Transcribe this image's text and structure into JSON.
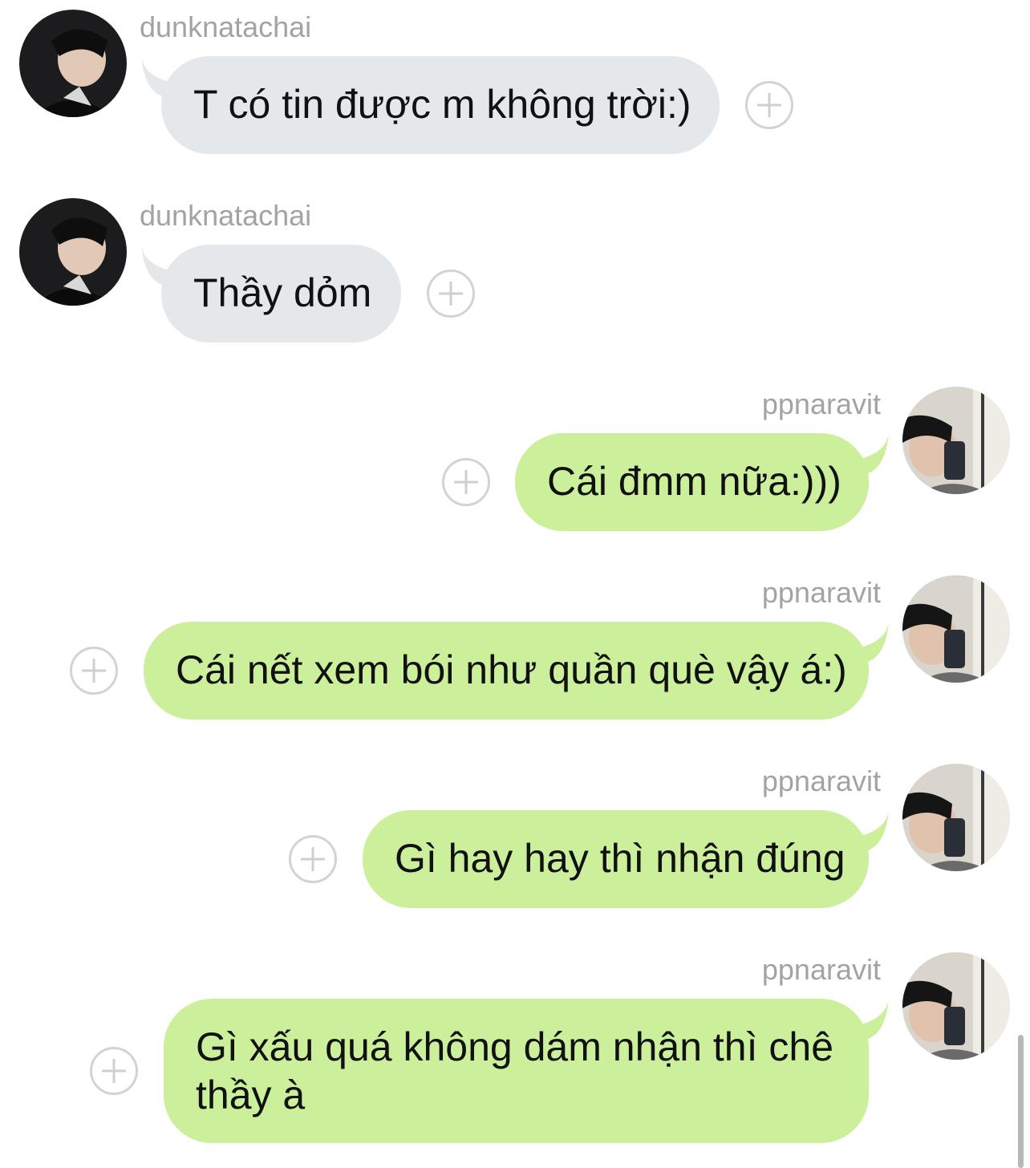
{
  "messages": [
    {
      "sender": "dunknatachai",
      "direction": "incoming",
      "text": "T có tin được m không trời:)",
      "avatar_icon": "user-avatar-dark"
    },
    {
      "sender": "dunknatachai",
      "direction": "incoming",
      "text": "Thầy dỏm",
      "avatar_icon": "user-avatar-dark"
    },
    {
      "sender": "ppnaravit",
      "direction": "outgoing",
      "text": "Cái đmm nữa:)))",
      "avatar_icon": "user-avatar-light"
    },
    {
      "sender": "ppnaravit",
      "direction": "outgoing",
      "text": "Cái nết xem bói như quần què vậy á:)",
      "avatar_icon": "user-avatar-light"
    },
    {
      "sender": "ppnaravit",
      "direction": "outgoing",
      "text": "Gì hay hay thì nhận đúng",
      "avatar_icon": "user-avatar-light"
    },
    {
      "sender": "ppnaravit",
      "direction": "outgoing",
      "text": "Gì xấu quá không dám nhận thì chê thầy à",
      "avatar_icon": "user-avatar-light"
    }
  ],
  "colors": {
    "incoming_bubble": "#e5e8eb",
    "outgoing_bubble": "#ccef9c",
    "username": "#a3a3a3",
    "plus_icon": "#d3d3d3"
  },
  "icons": {
    "add_reaction": "plus-circle-icon"
  }
}
